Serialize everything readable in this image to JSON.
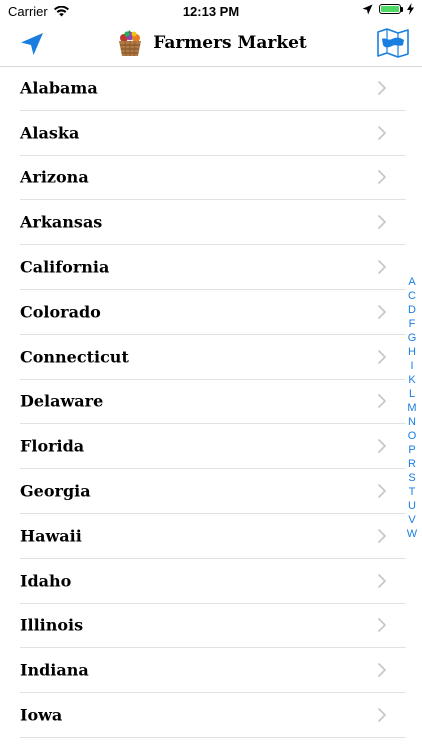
{
  "status_bar": {
    "carrier": "Carrier",
    "time": "12:13 PM",
    "battery_level": 1.0,
    "icons": [
      "wifi-icon",
      "location-arrow-icon",
      "battery-icon",
      "charging-bolt-icon"
    ]
  },
  "nav": {
    "title": "Farmers Market",
    "left_icon": "location-arrow-icon",
    "logo_icon": "produce-basket-icon",
    "right_icon": "map-icon"
  },
  "states": [
    "Alabama",
    "Alaska",
    "Arizona",
    "Arkansas",
    "California",
    "Colorado",
    "Connecticut",
    "Delaware",
    "Florida",
    "Georgia",
    "Hawaii",
    "Idaho",
    "Illinois",
    "Indiana",
    "Iowa"
  ],
  "index_letters": [
    "A",
    "C",
    "D",
    "F",
    "G",
    "H",
    "I",
    "K",
    "L",
    "M",
    "N",
    "O",
    "P",
    "R",
    "S",
    "T",
    "U",
    "V",
    "W"
  ],
  "colors": {
    "accent": "#1a7ee0",
    "separator": "#e2e2e2",
    "chevron": "#c4c4c9",
    "battery": "#4cd964"
  }
}
